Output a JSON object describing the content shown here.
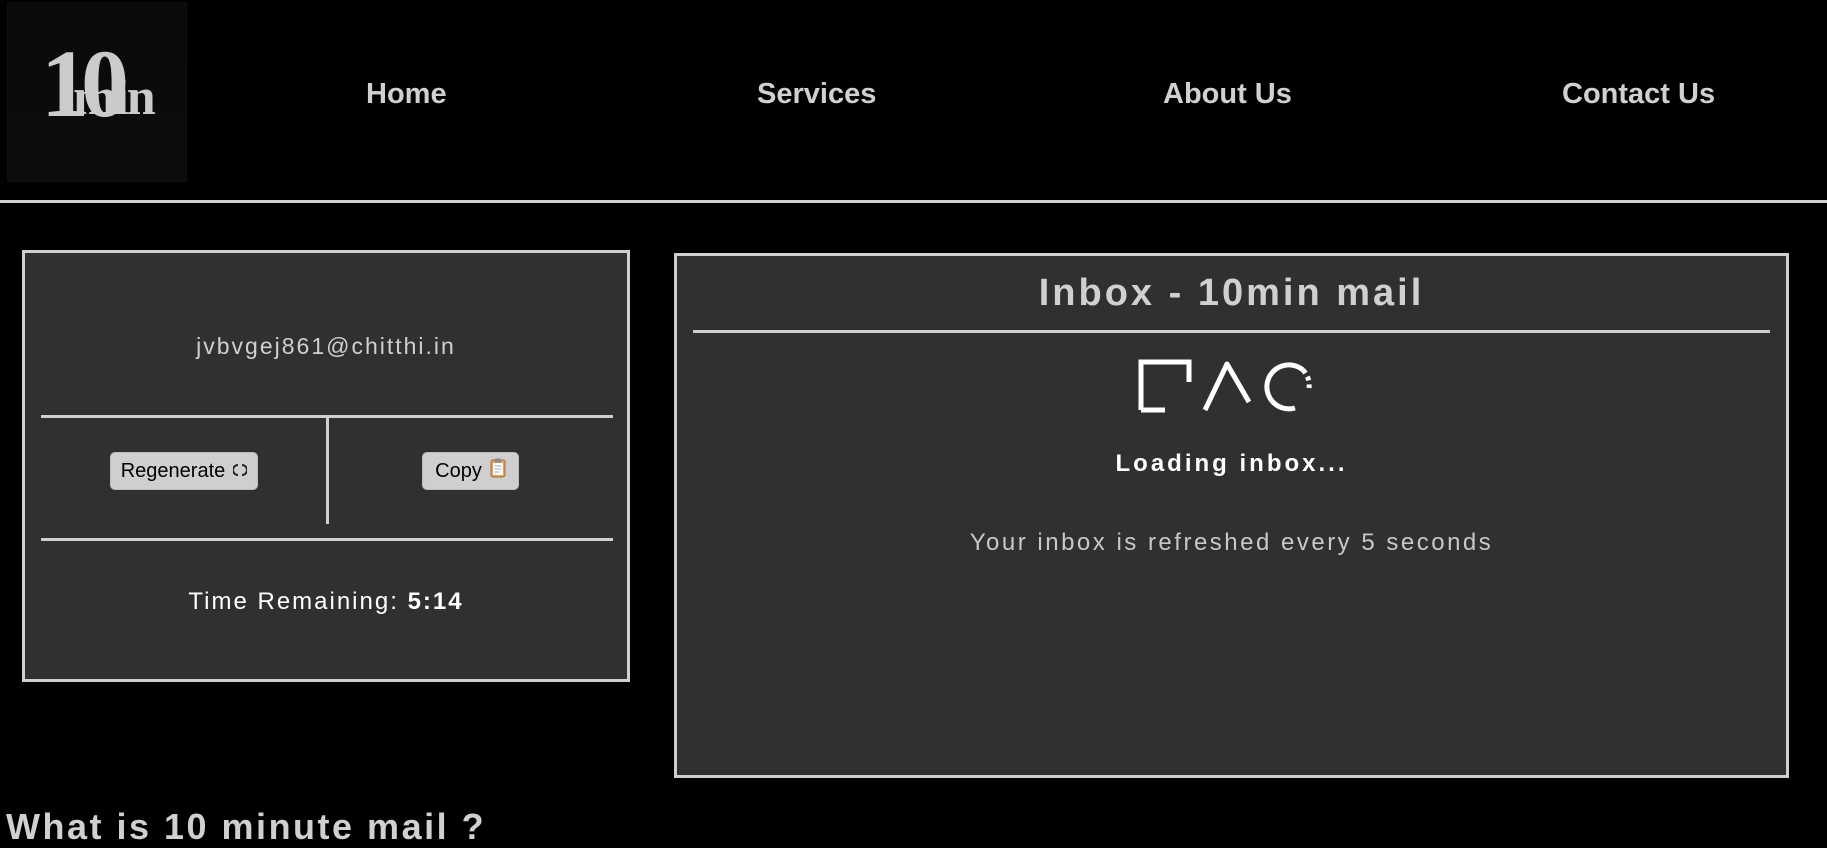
{
  "header": {
    "logo": {
      "big_text": "10",
      "small_text": "min"
    },
    "nav": [
      {
        "id": "home",
        "label": "Home"
      },
      {
        "id": "services",
        "label": "Services"
      },
      {
        "id": "about",
        "label": "About Us"
      },
      {
        "id": "contact",
        "label": "Contact Us"
      }
    ]
  },
  "email_panel": {
    "address": "jvbvgej861@chitthi.in",
    "regenerate_label": "Regenerate",
    "copy_label": "Copy",
    "time_label": "Time Remaining:",
    "time_value": "5:14"
  },
  "inbox": {
    "title": "Inbox - 10min mail",
    "loading_text": "Loading inbox...",
    "refresh_text": "Your inbox is refreshed every 5 seconds"
  },
  "content": {
    "section_heading": "What is 10 minute mail ?"
  },
  "icons": {
    "regenerate": "refresh-icon",
    "copy": "clipboard-icon",
    "loader": "loading-shapes-icon"
  },
  "colors": {
    "background": "#000000",
    "panel": "#303030",
    "border": "#cfcfcf",
    "text": "#d0d0d0",
    "button": "#cfcfcf"
  }
}
